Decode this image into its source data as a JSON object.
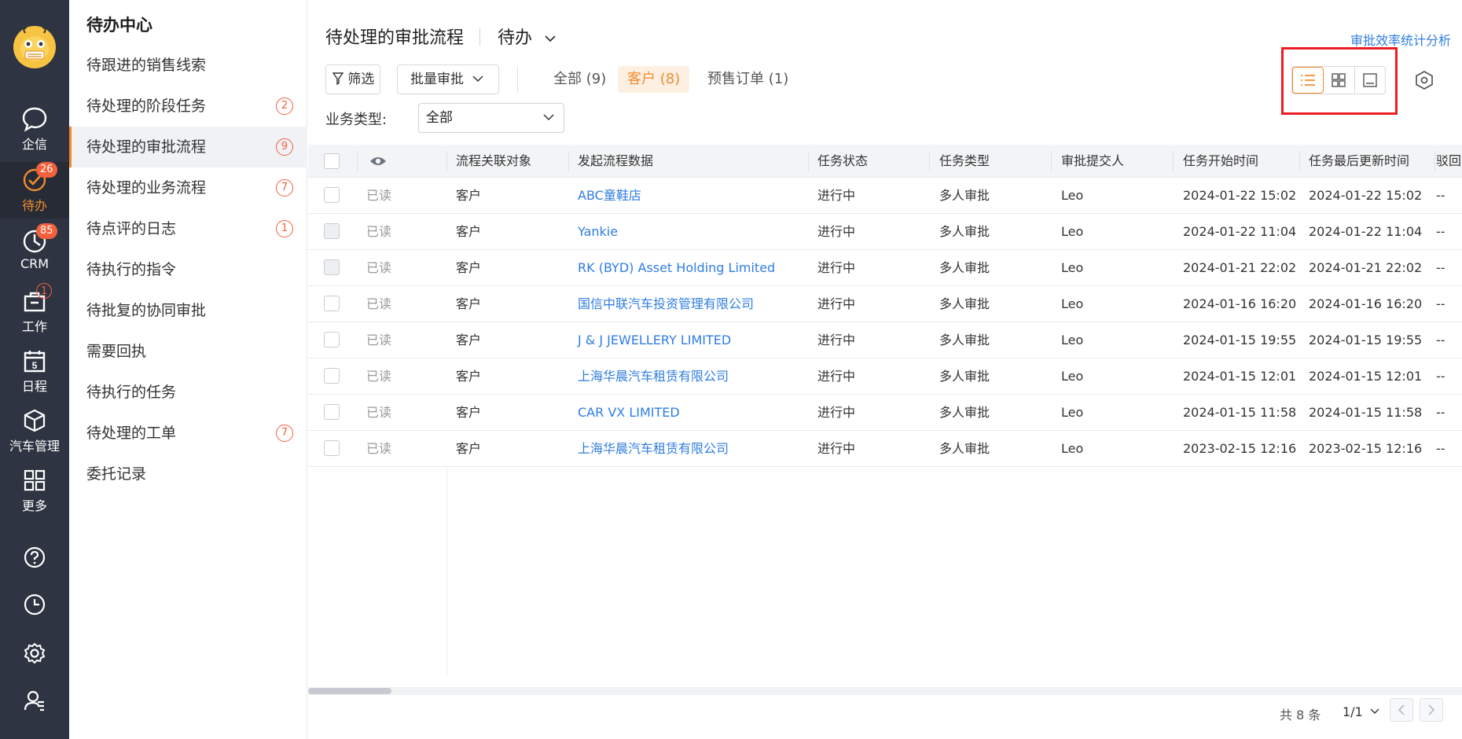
{
  "rail": {
    "items": [
      {
        "label": "企信",
        "icon": "chat-bubble-icon",
        "badge": ""
      },
      {
        "label": "待办",
        "icon": "check-circle-icon",
        "badge": "26"
      },
      {
        "label": "CRM",
        "icon": "clock-pie-icon",
        "badge": "85"
      },
      {
        "label": "工作",
        "icon": "briefcase-icon",
        "badge": "1"
      },
      {
        "label": "日程",
        "icon": "calendar-icon",
        "badge": "",
        "day": "5"
      },
      {
        "label": "汽车管理",
        "icon": "cube-icon",
        "badge": ""
      },
      {
        "label": "更多",
        "icon": "grid-icon",
        "badge": ""
      }
    ]
  },
  "menu": {
    "title": "待办中心",
    "items": [
      {
        "label": "待跟进的销售线索",
        "count": ""
      },
      {
        "label": "待处理的阶段任务",
        "count": "2"
      },
      {
        "label": "待处理的审批流程",
        "count": "9"
      },
      {
        "label": "待处理的业务流程",
        "count": "7"
      },
      {
        "label": "待点评的日志",
        "count": "1"
      },
      {
        "label": "待执行的指令",
        "count": ""
      },
      {
        "label": "待批复的协同审批",
        "count": ""
      },
      {
        "label": "需要回执",
        "count": ""
      },
      {
        "label": "待执行的任务",
        "count": ""
      },
      {
        "label": "待处理的工单",
        "count": "7"
      },
      {
        "label": "委托记录",
        "count": ""
      }
    ]
  },
  "header": {
    "title": "待处理的审批流程",
    "view": "待办",
    "stats_link": "审批效率统计分析"
  },
  "toolbar": {
    "filter": "筛选",
    "batch": "批量审批",
    "tabs": [
      "全部 (9)",
      "客户 (8)",
      "预售订单 (1)"
    ],
    "active_tab": 1,
    "biz_label": "业务类型:",
    "biz_value": "全部"
  },
  "table": {
    "columns": [
      "流程关联对象",
      "发起流程数据",
      "任务状态",
      "任务类型",
      "审批提交人",
      "任务开始时间",
      "任务最后更新时间",
      "驳回"
    ],
    "rows": [
      {
        "read": "已读",
        "object": "客户",
        "data": "ABC童鞋店",
        "status": "进行中",
        "type": "多人审批",
        "submitter": "Leo",
        "start": "2024-01-22 15:02",
        "updated": "2024-01-22 15:02",
        "reject": "--"
      },
      {
        "read": "已读",
        "object": "客户",
        "data": "Yankie",
        "status": "进行中",
        "type": "多人审批",
        "submitter": "Leo",
        "start": "2024-01-22 11:04",
        "updated": "2024-01-22 11:04",
        "reject": "--"
      },
      {
        "read": "已读",
        "object": "客户",
        "data": "RK (BYD) Asset Holding Limited",
        "status": "进行中",
        "type": "多人审批",
        "submitter": "Leo",
        "start": "2024-01-21 22:02",
        "updated": "2024-01-21 22:02",
        "reject": "--"
      },
      {
        "read": "已读",
        "object": "客户",
        "data": "国信中联汽车投资管理有限公司",
        "status": "进行中",
        "type": "多人审批",
        "submitter": "Leo",
        "start": "2024-01-16 16:20",
        "updated": "2024-01-16 16:20",
        "reject": "--"
      },
      {
        "read": "已读",
        "object": "客户",
        "data": "J & J JEWELLERY LIMITED",
        "status": "进行中",
        "type": "多人审批",
        "submitter": "Leo",
        "start": "2024-01-15 19:55",
        "updated": "2024-01-15 19:55",
        "reject": "--"
      },
      {
        "read": "已读",
        "object": "客户",
        "data": "上海华晨汽车租赁有限公司",
        "status": "进行中",
        "type": "多人审批",
        "submitter": "Leo",
        "start": "2024-01-15 12:01",
        "updated": "2024-01-15 12:01",
        "reject": "--"
      },
      {
        "read": "已读",
        "object": "客户",
        "data": "CAR VX LIMITED",
        "status": "进行中",
        "type": "多人审批",
        "submitter": "Leo",
        "start": "2024-01-15 11:58",
        "updated": "2024-01-15 11:58",
        "reject": "--"
      },
      {
        "read": "已读",
        "object": "客户",
        "data": "上海华晨汽车租赁有限公司",
        "status": "进行中",
        "type": "多人审批",
        "submitter": "Leo",
        "start": "2023-02-15 12:16",
        "updated": "2023-02-15 12:16",
        "reject": "--"
      }
    ]
  },
  "footer": {
    "total": "共 8 条",
    "page": "1/1"
  },
  "colors": {
    "accent": "#f28b2c",
    "link": "#2f7de1",
    "badge": "#f2603c",
    "rail": "#2e3441",
    "highlight": "#ec1c24"
  }
}
